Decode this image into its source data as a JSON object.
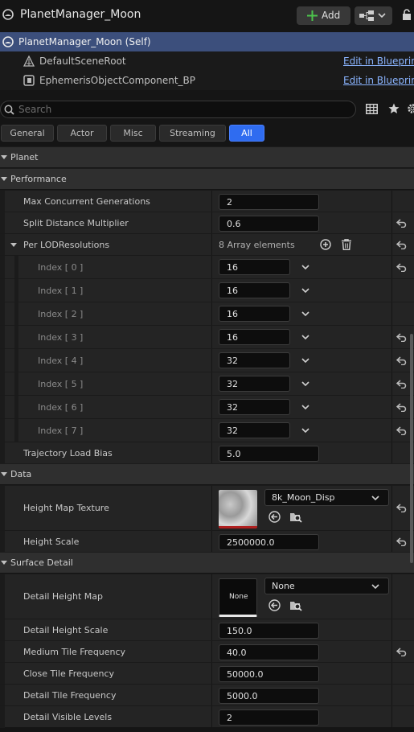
{
  "window": {
    "title": "PlanetManager_Moon",
    "add_label": "Add"
  },
  "components": [
    {
      "label": "PlanetManager_Moon (Self)",
      "link": ""
    },
    {
      "label": "DefaultSceneRoot",
      "link": "Edit in Blueprint"
    },
    {
      "label": "EphemerisObjectComponent_BP",
      "link": "Edit in Blueprint"
    }
  ],
  "search": {
    "placeholder": "Search"
  },
  "filter_tabs": [
    "General",
    "Actor",
    "Misc",
    "Streaming",
    "All"
  ],
  "active_tab": "All",
  "categories": {
    "planet": "Planet",
    "performance": "Performance",
    "data": "Data",
    "surface": "Surface Detail"
  },
  "performance": {
    "max_concurrent": {
      "label": "Max Concurrent Generations",
      "value": "2"
    },
    "split_distance": {
      "label": "Split Distance Multiplier",
      "value": "0.6"
    },
    "lod": {
      "label": "Per LODResolutions",
      "count": "8 Array elements"
    },
    "indices": [
      {
        "label": "Index [ 0 ]",
        "value": "16"
      },
      {
        "label": "Index [ 1 ]",
        "value": "16"
      },
      {
        "label": "Index [ 2 ]",
        "value": "16"
      },
      {
        "label": "Index [ 3 ]",
        "value": "16"
      },
      {
        "label": "Index [ 4 ]",
        "value": "32"
      },
      {
        "label": "Index [ 5 ]",
        "value": "32"
      },
      {
        "label": "Index [ 6 ]",
        "value": "32"
      },
      {
        "label": "Index [ 7 ]",
        "value": "32"
      }
    ],
    "trajectory": {
      "label": "Trajectory Load Bias",
      "value": "5.0"
    }
  },
  "data": {
    "height_map": {
      "label": "Height Map Texture",
      "asset": "8k_Moon_Disp"
    },
    "height_scale": {
      "label": "Height Scale",
      "value": "2500000.0"
    }
  },
  "surface": {
    "detail_map": {
      "label": "Detail Height Map",
      "asset": "None",
      "thumb": "None"
    },
    "rows": [
      {
        "label": "Detail Height Scale",
        "value": "150.0"
      },
      {
        "label": "Medium Tile Frequency",
        "value": "40.0"
      },
      {
        "label": "Close Tile Frequency",
        "value": "50000.0"
      },
      {
        "label": "Detail Tile Frequency",
        "value": "5000.0"
      },
      {
        "label": "Detail Visible Levels",
        "value": "2"
      }
    ]
  },
  "colors": {
    "accent": "#2f6cf0",
    "selection": "#3c4f7c",
    "link": "#8ab4ff"
  }
}
